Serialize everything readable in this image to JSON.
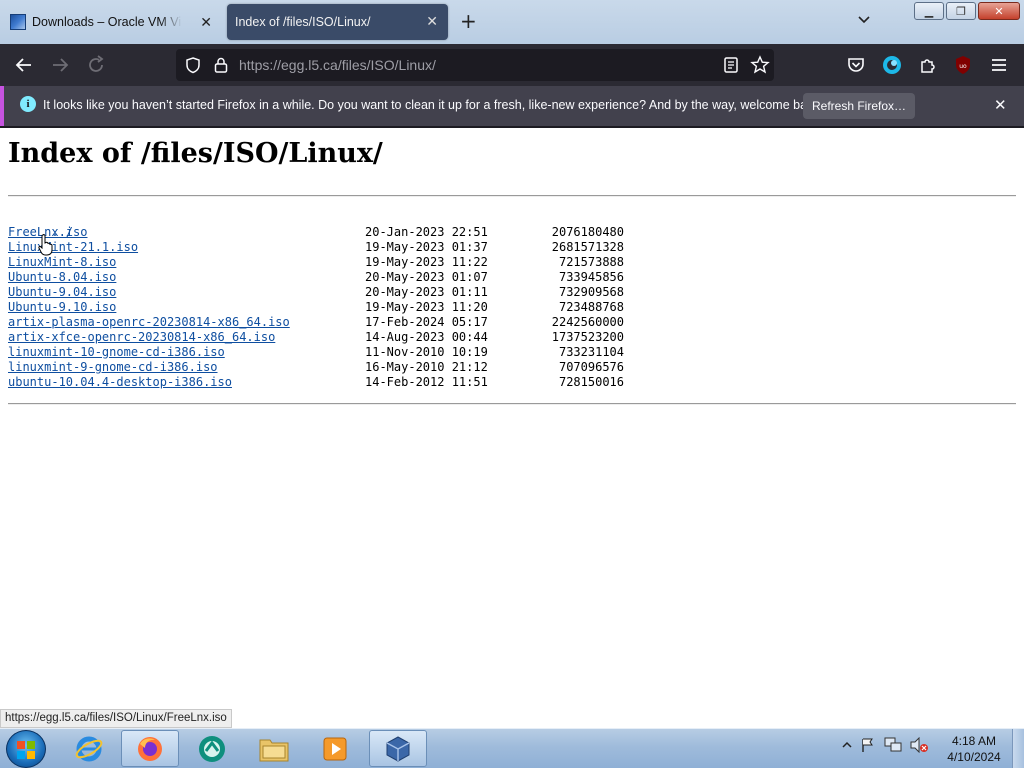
{
  "browser": {
    "tabs": [
      {
        "title": "Downloads – Oracle VM VirtualBox",
        "active": false
      },
      {
        "title": "Index of /files/ISO/Linux/",
        "active": true
      }
    ],
    "new_tab": "+",
    "close_glyph": "✕",
    "url_host": "https://egg.l5.ca",
    "url_path": "/files/ISO/Linux/",
    "window_buttons": {
      "minimize": "▁",
      "restore": "❐",
      "close": "✕"
    }
  },
  "notification": {
    "message": "It looks like you haven’t started Firefox in a while. Do you want to clean it up for a fresh, like-new experience? And by the way, welcome back!",
    "button": "Refresh Firefox…",
    "icon": "i",
    "accent": "#c653e0"
  },
  "page": {
    "heading": "Index of /files/ISO/Linux/",
    "parent": "../",
    "files": [
      {
        "name": "FreeLnx.iso",
        "date": "20-Jan-2023 22:51",
        "size": "2076180480"
      },
      {
        "name": "LinuxMint-21.1.iso",
        "date": "19-May-2023 01:37",
        "size": "2681571328"
      },
      {
        "name": "LinuxMint-8.iso",
        "date": "19-May-2023 11:22",
        "size": "721573888"
      },
      {
        "name": "Ubuntu-8.04.iso",
        "date": "20-May-2023 01:07",
        "size": "733945856"
      },
      {
        "name": "Ubuntu-9.04.iso",
        "date": "20-May-2023 01:11",
        "size": "732909568"
      },
      {
        "name": "Ubuntu-9.10.iso",
        "date": "19-May-2023 11:20",
        "size": "723488768"
      },
      {
        "name": "artix-plasma-openrc-20230814-x86_64.iso",
        "date": "17-Feb-2024 05:17",
        "size": "2242560000"
      },
      {
        "name": "artix-xfce-openrc-20230814-x86_64.iso",
        "date": "14-Aug-2023 00:44",
        "size": "1737523200"
      },
      {
        "name": "linuxmint-10-gnome-cd-i386.iso",
        "date": "11-Nov-2010 10:19",
        "size": "733231104"
      },
      {
        "name": "linuxmint-9-gnome-cd-i386.iso",
        "date": "16-May-2010 21:12",
        "size": "707096576"
      },
      {
        "name": "ubuntu-10.04.4-desktop-i386.iso",
        "date": "14-Feb-2012 11:51",
        "size": "728150016"
      }
    ]
  },
  "status_link": "https://egg.l5.ca/files/ISO/Linux/FreeLnx.iso",
  "taskbar": {
    "items": [
      "internet-explorer-icon",
      "firefox-icon",
      "app-icon",
      "file-explorer-icon",
      "media-player-icon",
      "virtualbox-icon"
    ],
    "clock_time": "4:18 AM",
    "clock_date": "4/10/2024"
  },
  "colors": {
    "link": "#0e4ea0",
    "toolbar": "#2b2a33",
    "notification": "#42414d"
  }
}
